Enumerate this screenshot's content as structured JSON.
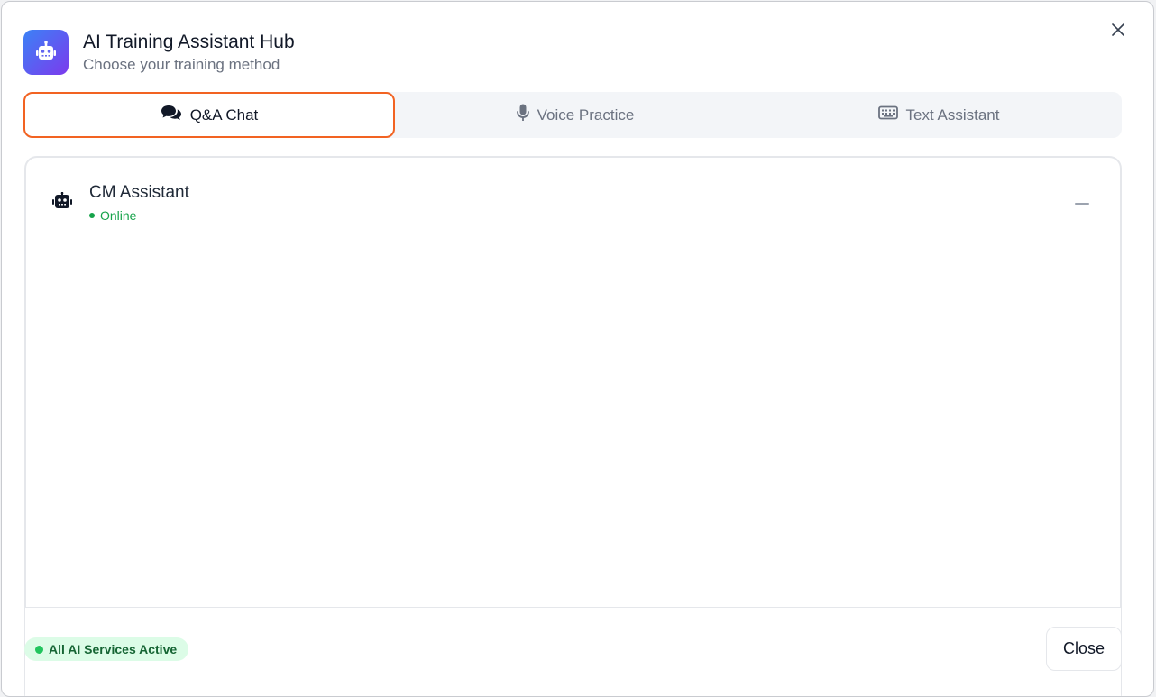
{
  "header": {
    "title": "AI Training Assistant Hub",
    "subtitle": "Choose your training method"
  },
  "tabs": [
    {
      "label": "Q&A Chat",
      "icon": "chat-bubbles-icon",
      "active": true
    },
    {
      "label": "Voice Practice",
      "icon": "microphone-icon",
      "active": false
    },
    {
      "label": "Text Assistant",
      "icon": "keyboard-icon",
      "active": false
    }
  ],
  "chat": {
    "assistant_name": "CM Assistant",
    "status": "Online"
  },
  "footer": {
    "services_status": "All AI Services Active",
    "close_label": "Close"
  },
  "colors": {
    "accent": "#f26322",
    "online": "#16a34a",
    "logo_gradient_start": "#3b82f6",
    "logo_gradient_end": "#7c3aed"
  }
}
